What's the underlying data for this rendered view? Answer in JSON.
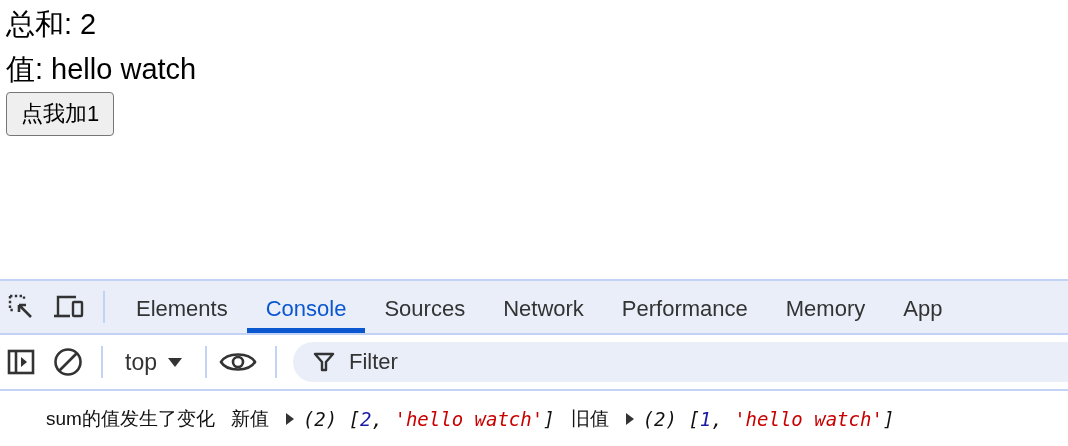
{
  "page": {
    "sum_line": "总和: 2",
    "value_line": "值: hello watch",
    "button": "点我加1"
  },
  "devtools": {
    "tabs": [
      {
        "label": "Elements",
        "selected": false
      },
      {
        "label": "Console",
        "selected": true
      },
      {
        "label": "Sources",
        "selected": false
      },
      {
        "label": "Network",
        "selected": false
      },
      {
        "label": "Performance",
        "selected": false
      },
      {
        "label": "Memory",
        "selected": false
      },
      {
        "label": "App",
        "selected": false
      }
    ],
    "context": "top",
    "filter": {
      "placeholder": "Filter"
    },
    "messages": [
      {
        "parts": [
          {
            "kind": "text",
            "text": "sum的值发生了变化"
          },
          {
            "kind": "text",
            "text": "新值"
          },
          {
            "kind": "array",
            "segments": [
              {
                "kind": "meta",
                "text": "(2) ["
              },
              {
                "kind": "number",
                "text": "2"
              },
              {
                "kind": "meta",
                "text": ", "
              },
              {
                "kind": "string",
                "text": "'hello watch'"
              },
              {
                "kind": "meta",
                "text": "]"
              }
            ]
          },
          {
            "kind": "text",
            "text": "旧值"
          },
          {
            "kind": "array",
            "segments": [
              {
                "kind": "meta",
                "text": "(2) ["
              },
              {
                "kind": "number",
                "text": "1"
              },
              {
                "kind": "meta",
                "text": ", "
              },
              {
                "kind": "string",
                "text": "'hello watch'"
              },
              {
                "kind": "meta",
                "text": "]"
              }
            ]
          }
        ]
      }
    ]
  }
}
